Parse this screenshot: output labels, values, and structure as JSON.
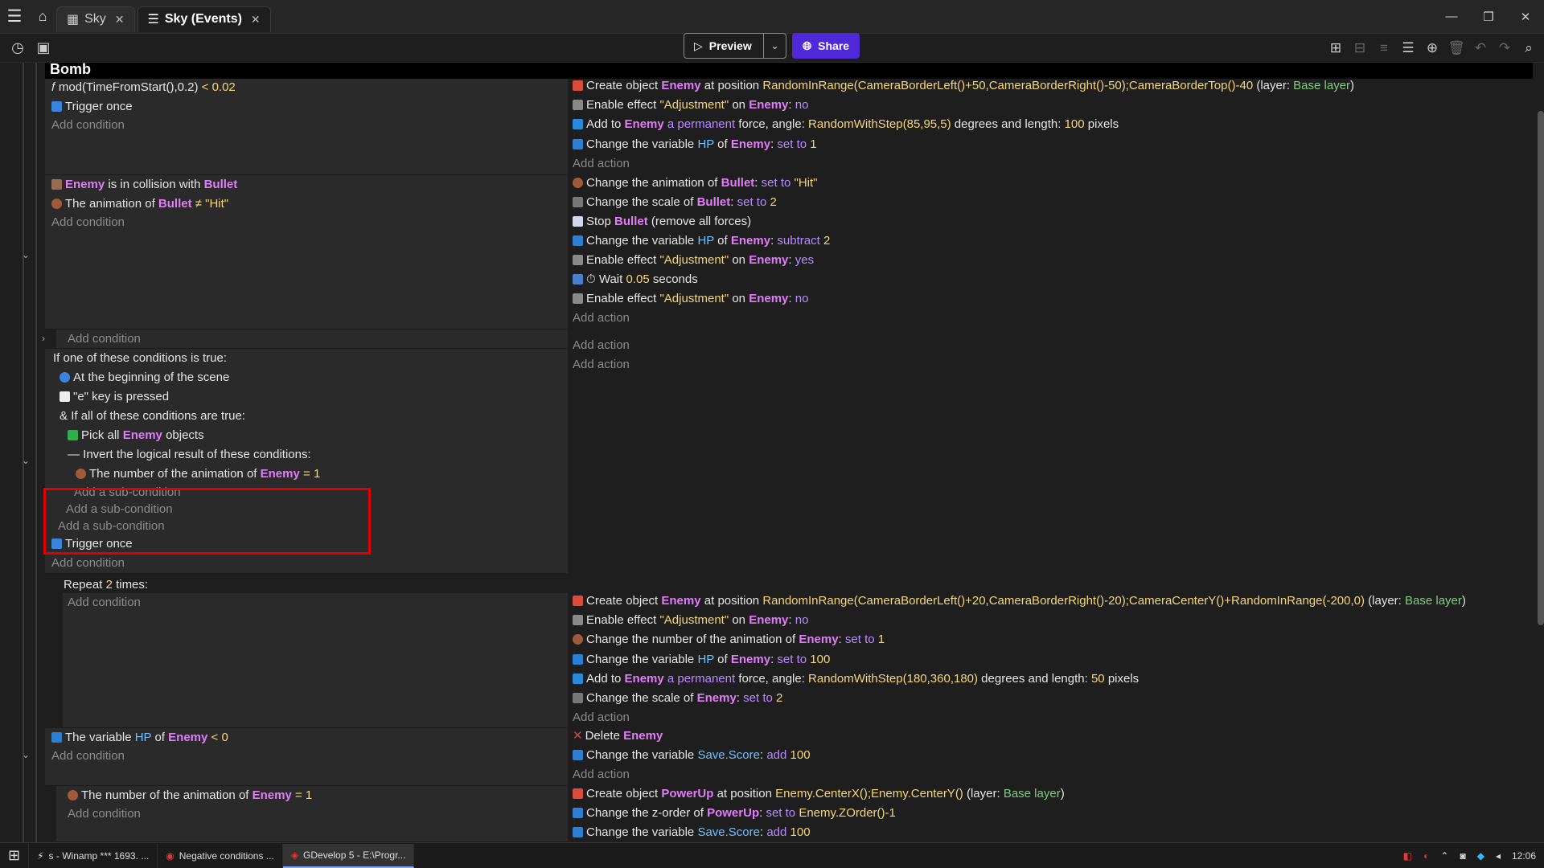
{
  "tabs": [
    {
      "label": "Sky"
    },
    {
      "label": "Sky (Events)"
    }
  ],
  "toolbar": {
    "preview_label": "Preview",
    "share_label": "Share"
  },
  "group_title": "Bomb",
  "events": {
    "e1": {
      "conditions": [
        "mod(TimeFromStart(),0.2)",
        "< ",
        "0.02",
        "Trigger once",
        "Add condition"
      ],
      "actions": [
        "Add action"
      ]
    },
    "e2": {
      "add_condition": "Add condition",
      "add_action": "Add action"
    },
    "sub": {
      "add_condition": "Add condition",
      "add_action_1": "Add action",
      "add_action_2": "Add action"
    },
    "or": {
      "title": "If one of these conditions is true:",
      "c1": "At the beginning of the scene",
      "c2": "\"e\" key is pressed",
      "and_title": "If all of these conditions are true:",
      "pick": "Pick all",
      "pick_obj": "Enemy",
      "pick_end": "objects",
      "invert": "Invert the logical result of these conditions:",
      "anim": "The number of the animation of",
      "anim_obj": "Enemy",
      "anim_val": "= 1",
      "sub1": "Add a sub-condition",
      "sub2": "Add a sub-condition",
      "sub3": "Add a sub-condition",
      "trigger": "Trigger once",
      "add_condition": "Add condition"
    },
    "repeat": {
      "label": "Repeat",
      "count": "2",
      "times": "times:",
      "add_condition": "Add condition",
      "add_action": "Add action"
    },
    "e5": {
      "add_condition": "Add condition",
      "add_action": "Add action"
    },
    "e6": {
      "add_condition": "Add condition"
    }
  },
  "taskbar": [
    {
      "label": "s - Winamp *** 1693. ..."
    },
    {
      "label": "Negative conditions ..."
    },
    {
      "label": "GDevelop 5 - E:\\Progr..."
    }
  ],
  "clock": "12:06"
}
